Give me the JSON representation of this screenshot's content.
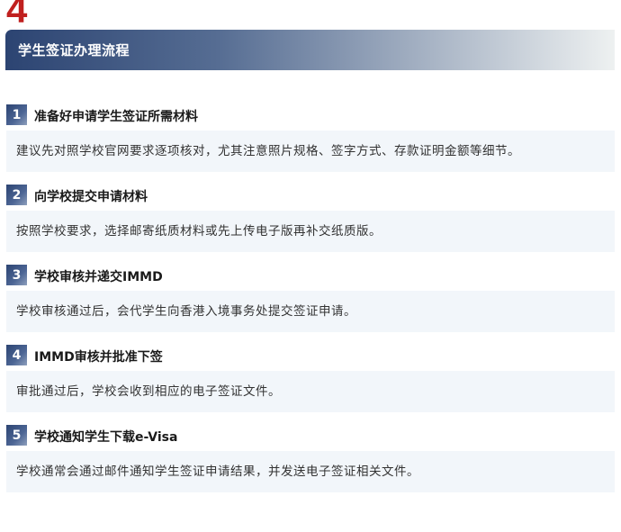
{
  "section": {
    "number": "4",
    "title": "学生签证办理流程"
  },
  "steps": [
    {
      "num": "1",
      "title": "准备好申请学生签证所需材料",
      "body": "建议先对照学校官网要求逐项核对，尤其注意照片规格、签字方式、存款证明金额等细节。"
    },
    {
      "num": "2",
      "title": "向学校提交申请材料",
      "body": "按照学校要求，选择邮寄纸质材料或先上传电子版再补交纸质版。"
    },
    {
      "num": "3",
      "title": "学校审核并递交IMMD",
      "body": "学校审核通过后，会代学生向香港入境事务处提交签证申请。"
    },
    {
      "num": "4",
      "title": "IMMD审核并批准下签",
      "body": "审批通过后，学校会收到相应的电子签证文件。"
    },
    {
      "num": "5",
      "title": "学校通知学生下载e-Visa",
      "body": "学校通常会通过邮件通知学生签证申请结果，并发送电子签证相关文件。"
    }
  ]
}
